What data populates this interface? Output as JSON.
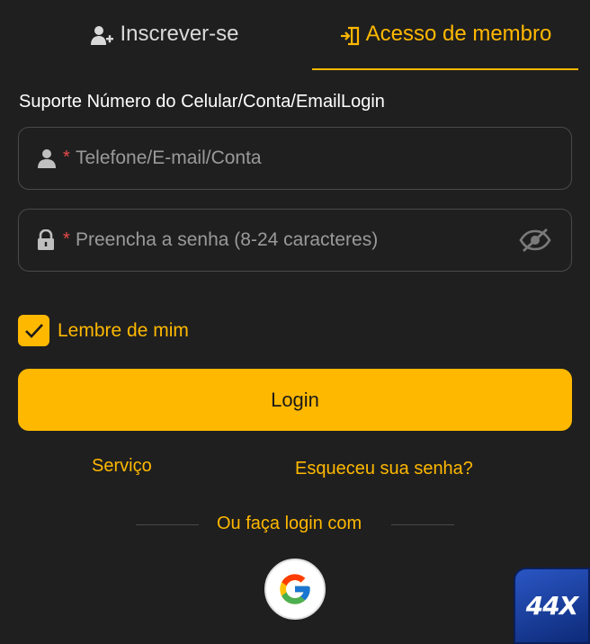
{
  "tabs": {
    "register_label": "Inscrever-se",
    "login_label": "Acesso de membro",
    "active": "login"
  },
  "form": {
    "support_text": "Suporte Número do Celular/Conta/EmailLogin",
    "account_placeholder": "Telefone/E-mail/Conta",
    "password_placeholder": "Preencha a senha (8-24 caracteres)",
    "required_mark": "*",
    "remember_label": "Lembre de mim",
    "remember_checked": true,
    "login_button": "Login"
  },
  "links": {
    "service": "Serviço",
    "forgot_password": "Esqueceu sua senha?"
  },
  "social": {
    "divider_text": "Ou faça login com",
    "google_icon": "google-icon"
  },
  "badge": {
    "text": "44X"
  },
  "colors": {
    "background": "#1f1f1f",
    "accent": "#ffb800",
    "border": "#4a4a4a",
    "required": "#e94a4a"
  }
}
